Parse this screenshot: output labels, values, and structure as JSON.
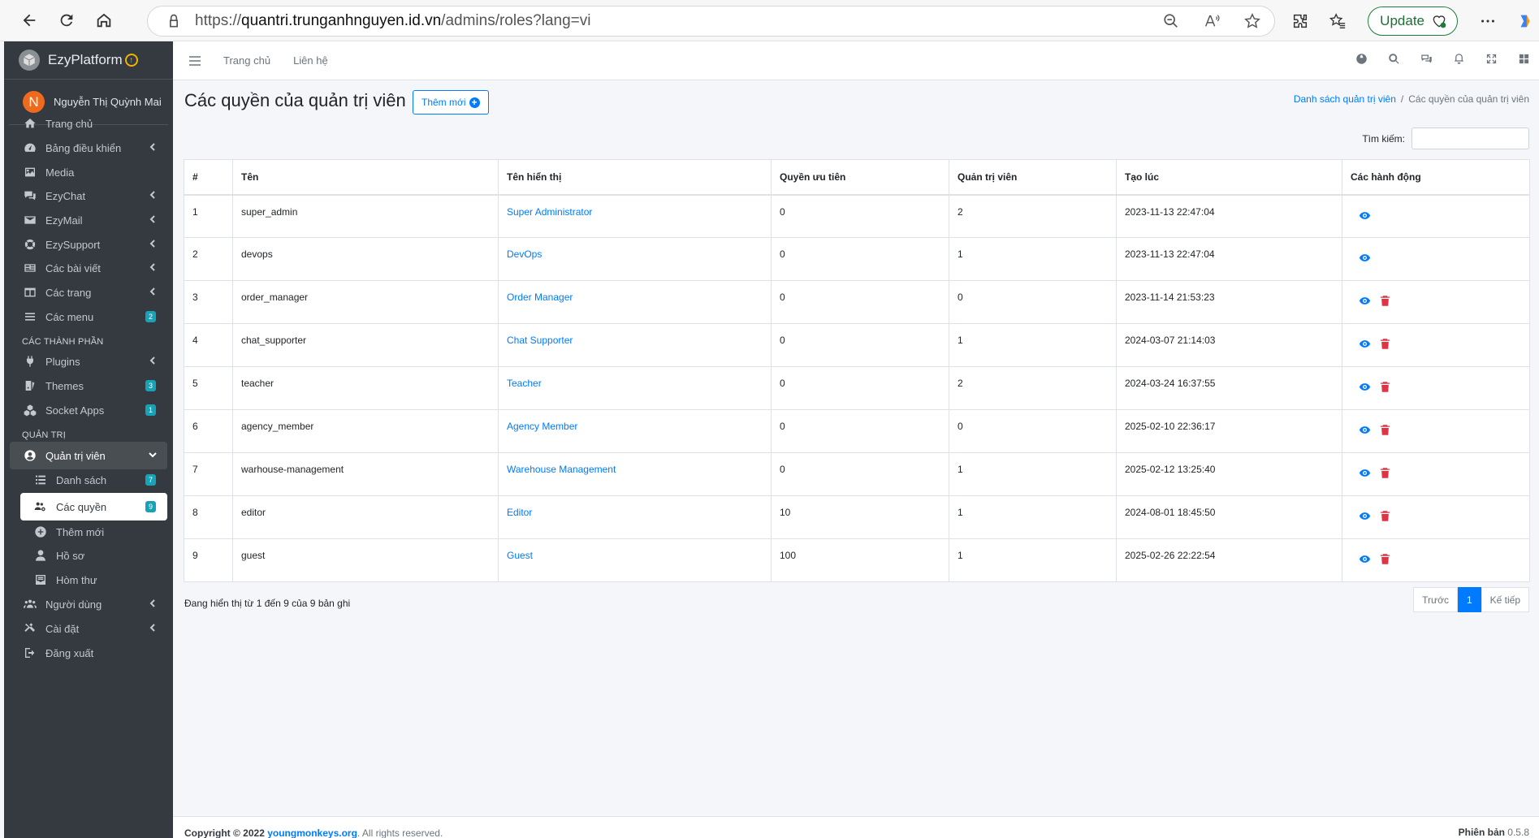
{
  "browser": {
    "url_prefix": "https://",
    "url_host": "quantri.trunganhnguyen.id.vn",
    "url_path": "/admins/roles?lang=vi",
    "update_label": "Update"
  },
  "sidebar": {
    "brand": "EzyPlatform",
    "avatar_letter": "N",
    "user_name": "Nguyễn Thị Quỳnh Mai",
    "items": [
      {
        "label": "Trang chủ",
        "icon": "home-icon"
      },
      {
        "label": "Bảng điều khiển",
        "icon": "dashboard-icon"
      },
      {
        "label": "Media",
        "icon": "image-icon"
      },
      {
        "label": "EzyChat",
        "icon": "comments-icon"
      },
      {
        "label": "EzyMail",
        "icon": "envelope-icon"
      },
      {
        "label": "EzySupport",
        "icon": "support-icon"
      },
      {
        "label": "Các bài viết",
        "icon": "newspaper-icon"
      },
      {
        "label": "Các trang",
        "icon": "columns-icon"
      },
      {
        "label": "Các menu",
        "icon": "bars-icon",
        "badge": "2"
      }
    ],
    "section_components": "CÁC THÀNH PHẦN",
    "component_items": [
      {
        "label": "Plugins",
        "icon": "plug-icon"
      },
      {
        "label": "Themes",
        "icon": "palette-icon",
        "badge": "3"
      },
      {
        "label": "Socket Apps",
        "icon": "cubes-icon",
        "badge": "1"
      }
    ],
    "section_admin": "QUẢN TRỊ",
    "admin_item": "Quản trị viên",
    "admin_sub": [
      {
        "label": "Danh sách",
        "badge": "7"
      },
      {
        "label": "Các quyền",
        "badge": "9"
      },
      {
        "label": "Thêm mới"
      },
      {
        "label": "Hồ sơ"
      },
      {
        "label": "Hòm thư"
      }
    ],
    "bottom_items": [
      {
        "label": "Người dùng"
      },
      {
        "label": "Cài đặt"
      },
      {
        "label": "Đăng xuất"
      }
    ]
  },
  "topnav": {
    "home": "Trang chủ",
    "contact": "Liên hệ"
  },
  "page": {
    "title": "Các quyền của quản trị viên",
    "add_label": "Thêm mới",
    "breadcrumb_parent": "Danh sách quản trị viên",
    "breadcrumb_sep": "/",
    "breadcrumb_current": "Các quyền của quản trị viên",
    "search_label": "Tìm kiếm:"
  },
  "table": {
    "headers": [
      "#",
      "Tên",
      "Tên hiển thị",
      "Quyền ưu tiên",
      "Quản trị viên",
      "Tạo lúc",
      "Các hành động"
    ],
    "rows": [
      {
        "n": "1",
        "name": "super_admin",
        "display": "Super Administrator",
        "priority": "0",
        "admins": "2",
        "created": "2023-11-13 22:47:04",
        "delete": false
      },
      {
        "n": "2",
        "name": "devops",
        "display": "DevOps",
        "priority": "0",
        "admins": "1",
        "created": "2023-11-13 22:47:04",
        "delete": false
      },
      {
        "n": "3",
        "name": "order_manager",
        "display": "Order Manager",
        "priority": "0",
        "admins": "0",
        "created": "2023-11-14 21:53:23",
        "delete": true
      },
      {
        "n": "4",
        "name": "chat_supporter",
        "display": "Chat Supporter",
        "priority": "0",
        "admins": "1",
        "created": "2024-03-07 21:14:03",
        "delete": true
      },
      {
        "n": "5",
        "name": "teacher",
        "display": "Teacher",
        "priority": "0",
        "admins": "2",
        "created": "2024-03-24 16:37:55",
        "delete": true
      },
      {
        "n": "6",
        "name": "agency_member",
        "display": "Agency Member",
        "priority": "0",
        "admins": "0",
        "created": "2025-02-10 22:36:17",
        "delete": true
      },
      {
        "n": "7",
        "name": "warhouse-management",
        "display": "Warehouse Management",
        "priority": "0",
        "admins": "1",
        "created": "2025-02-12 13:25:40",
        "delete": true
      },
      {
        "n": "8",
        "name": "editor",
        "display": "Editor",
        "priority": "10",
        "admins": "1",
        "created": "2024-08-01 18:45:50",
        "delete": true
      },
      {
        "n": "9",
        "name": "guest",
        "display": "Guest",
        "priority": "100",
        "admins": "1",
        "created": "2025-02-26 22:22:54",
        "delete": true
      }
    ]
  },
  "info": "Đang hiển thị từ 1 đến 9 của 9 bản ghi",
  "pager": {
    "prev": "Trước",
    "current": "1",
    "next": "Kế tiếp"
  },
  "footer": {
    "copyright": "Copyright © 2022",
    "link": "youngmonkeys.org",
    "rights": ". All rights reserved.",
    "version_label": "Phiên bản",
    "version": "0.5.8"
  },
  "colors": {
    "sidebar": "#343a40",
    "primary": "#007bff",
    "danger": "#dc3545",
    "badge": "#17a2b8"
  }
}
